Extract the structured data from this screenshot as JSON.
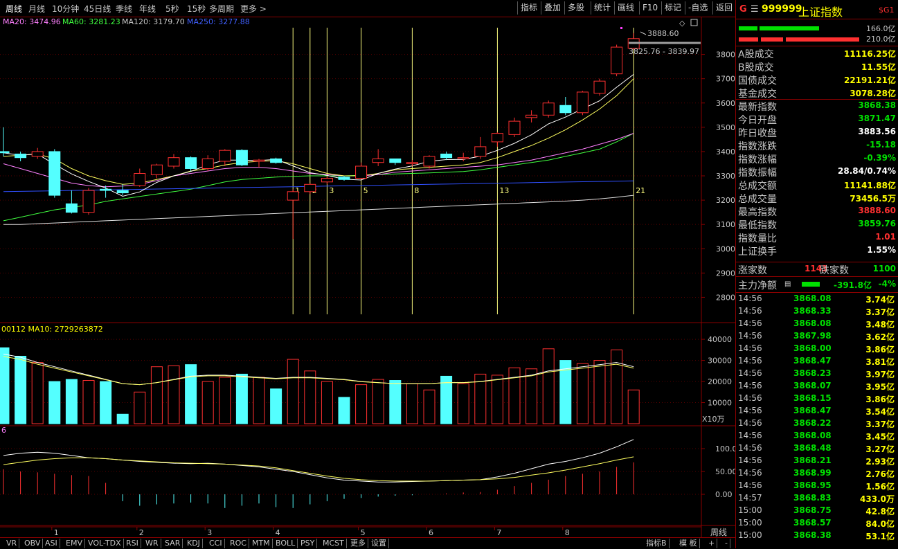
{
  "toolbar": {
    "periods": [
      "周线",
      "月线",
      "10分钟",
      "45日线",
      "季线",
      "年线",
      "5秒",
      "15秒",
      "多周期",
      "更多 >"
    ],
    "active_period": "周线",
    "buttons": [
      "指标",
      "叠加",
      "多股",
      "统计",
      "画线",
      "F10",
      "标记",
      "-自选",
      "返回"
    ]
  },
  "legend": {
    "ma20": "MA20: 3474.96",
    "ma60": "MA60: 3281.23",
    "ma120": "MA120: 3179.70",
    "ma250": "MA250: 3277.88",
    "volume": "00112  MA10: 2729263872",
    "macd_lbl": "6"
  },
  "annotations": {
    "high_price": "3888.60",
    "range": "3825.76 - 3839.97"
  },
  "fib_labels": [
    "1",
    "2",
    "3",
    "5",
    "8",
    "13",
    "21"
  ],
  "volume_unit": "X10万",
  "x_period": "周线",
  "bottom_tabs": [
    "VR",
    "OBV",
    "ASI",
    "EMV",
    "VOL-TDX",
    "RSI",
    "WR",
    "SAR",
    "KDJ",
    "CCI",
    "ROC",
    "MTM",
    "BOLL",
    "PSY",
    "MCST",
    "更多",
    "设置"
  ],
  "bottom_right": [
    "指标B",
    "模 板",
    "+",
    "-"
  ],
  "header": {
    "code": "999999",
    "name": "上证指数",
    "tag": "$G1",
    "g_tag": "G"
  },
  "bars": {
    "v1": "166.0亿",
    "v2": "210.0亿"
  },
  "stats": [
    {
      "label": "A股成交",
      "value": "11116.25亿",
      "color": "#ffff00"
    },
    {
      "label": "B股成交",
      "value": "11.55亿",
      "color": "#ffff00"
    },
    {
      "label": "国债成交",
      "value": "22191.21亿",
      "color": "#ffff00"
    },
    {
      "label": "基金成交",
      "value": "3078.28亿",
      "color": "#ffff00"
    },
    {
      "label": "最新指数",
      "value": "3868.38",
      "color": "#00e000"
    },
    {
      "label": "今日开盘",
      "value": "3871.47",
      "color": "#00e000"
    },
    {
      "label": "昨日收盘",
      "value": "3883.56",
      "color": "#ffffff"
    },
    {
      "label": "指数涨跌",
      "value": "-15.18",
      "color": "#00e000"
    },
    {
      "label": "指数涨幅",
      "value": "-0.39%",
      "color": "#00e000"
    },
    {
      "label": "指数振幅",
      "value": "28.84/0.74%",
      "color": "#ffffff"
    },
    {
      "label": "总成交额",
      "value": "11141.88亿",
      "color": "#ffff00"
    },
    {
      "label": "总成交量",
      "value": "73456.5万",
      "color": "#ffff00"
    },
    {
      "label": "最高指数",
      "value": "3888.60",
      "color": "#ff3030"
    },
    {
      "label": "最低指数",
      "value": "3859.76",
      "color": "#00e000"
    },
    {
      "label": "指数量比",
      "value": "1.01",
      "color": "#ff3030"
    },
    {
      "label": "上证换手",
      "value": "1.55%",
      "color": "#ffffff"
    }
  ],
  "updown": {
    "up_label": "涨家数",
    "up": "1143",
    "down_label": "跌家数",
    "down": "1100"
  },
  "mainflow": {
    "label": "主力净额",
    "value": "-391.8亿",
    "pct": "-4%"
  },
  "ticks": [
    {
      "t": "14:56",
      "p": "3868.08",
      "v": "3.74亿"
    },
    {
      "t": "14:56",
      "p": "3868.33",
      "v": "3.37亿"
    },
    {
      "t": "14:56",
      "p": "3868.08",
      "v": "3.48亿"
    },
    {
      "t": "14:56",
      "p": "3867.98",
      "v": "3.62亿"
    },
    {
      "t": "14:56",
      "p": "3868.00",
      "v": "3.86亿"
    },
    {
      "t": "14:56",
      "p": "3868.47",
      "v": "3.81亿"
    },
    {
      "t": "14:56",
      "p": "3868.23",
      "v": "3.97亿"
    },
    {
      "t": "14:56",
      "p": "3868.07",
      "v": "3.95亿"
    },
    {
      "t": "14:56",
      "p": "3868.15",
      "v": "3.86亿"
    },
    {
      "t": "14:56",
      "p": "3868.47",
      "v": "3.54亿"
    },
    {
      "t": "14:56",
      "p": "3868.22",
      "v": "3.37亿"
    },
    {
      "t": "14:56",
      "p": "3868.08",
      "v": "3.45亿"
    },
    {
      "t": "14:56",
      "p": "3868.48",
      "v": "3.27亿"
    },
    {
      "t": "14:56",
      "p": "3868.21",
      "v": "2.93亿"
    },
    {
      "t": "14:56",
      "p": "3868.99",
      "v": "2.76亿"
    },
    {
      "t": "14:56",
      "p": "3868.95",
      "v": "1.56亿"
    },
    {
      "t": "14:57",
      "p": "3868.83",
      "v": "433.0万"
    },
    {
      "t": "15:00",
      "p": "3868.75",
      "v": "42.8亿"
    },
    {
      "t": "15:00",
      "p": "3868.57",
      "v": "84.0亿"
    },
    {
      "t": "15:00",
      "p": "3868.38",
      "v": "53.1亿"
    }
  ],
  "chart_data": {
    "type": "candlestick",
    "price_ticks": [
      3800,
      3700,
      3600,
      3500,
      3400,
      3300,
      3200,
      3100,
      3000,
      2900,
      2800
    ],
    "price_range": [
      2730,
      3910
    ],
    "x_month_labels": [
      "1",
      "2",
      "3",
      "4",
      "5",
      "6",
      "7",
      "8"
    ],
    "x_month_index": [
      3,
      8,
      12,
      16,
      21,
      25,
      29,
      33
    ],
    "fib_index": [
      17,
      18,
      19,
      21,
      24,
      29,
      37
    ],
    "candles": [
      {
        "o": 3400,
        "c": 3395,
        "h": 3500,
        "l": 3380
      },
      {
        "o": 3390,
        "c": 3375,
        "h": 3400,
        "l": 3360
      },
      {
        "o": 3380,
        "c": 3400,
        "h": 3415,
        "l": 3370
      },
      {
        "o": 3400,
        "c": 3220,
        "h": 3410,
        "l": 3210
      },
      {
        "o": 3185,
        "c": 3150,
        "h": 3240,
        "l": 3145
      },
      {
        "o": 3150,
        "c": 3240,
        "h": 3250,
        "l": 3140
      },
      {
        "o": 3245,
        "c": 3240,
        "h": 3260,
        "l": 3210
      },
      {
        "o": 3240,
        "c": 3230,
        "h": 3265,
        "l": 3220
      },
      {
        "o": 3260,
        "c": 3310,
        "h": 3330,
        "l": 3255
      },
      {
        "o": 3305,
        "c": 3345,
        "h": 3350,
        "l": 3290
      },
      {
        "o": 3340,
        "c": 3375,
        "h": 3390,
        "l": 3330
      },
      {
        "o": 3375,
        "c": 3330,
        "h": 3380,
        "l": 3320
      },
      {
        "o": 3330,
        "c": 3370,
        "h": 3385,
        "l": 3320
      },
      {
        "o": 3360,
        "c": 3405,
        "h": 3410,
        "l": 3340
      },
      {
        "o": 3405,
        "c": 3345,
        "h": 3410,
        "l": 3340
      },
      {
        "o": 3360,
        "c": 3365,
        "h": 3370,
        "l": 3335
      },
      {
        "o": 3370,
        "c": 3355,
        "h": 3375,
        "l": 3350
      },
      {
        "o": 3200,
        "c": 3235,
        "h": 3245,
        "l": 3040
      },
      {
        "o": 3235,
        "c": 3265,
        "h": 3270,
        "l": 3225
      },
      {
        "o": 3275,
        "c": 3290,
        "h": 3300,
        "l": 3265
      },
      {
        "o": 3295,
        "c": 3285,
        "h": 3300,
        "l": 3280
      },
      {
        "o": 3290,
        "c": 3340,
        "h": 3355,
        "l": 3285
      },
      {
        "o": 3355,
        "c": 3370,
        "h": 3410,
        "l": 3340
      },
      {
        "o": 3370,
        "c": 3355,
        "h": 3370,
        "l": 3345
      },
      {
        "o": 3350,
        "c": 3355,
        "h": 3365,
        "l": 3340
      },
      {
        "o": 3340,
        "c": 3380,
        "h": 3385,
        "l": 3330
      },
      {
        "o": 3390,
        "c": 3375,
        "h": 3400,
        "l": 3365
      },
      {
        "o": 3370,
        "c": 3375,
        "h": 3395,
        "l": 3360
      },
      {
        "o": 3380,
        "c": 3420,
        "h": 3460,
        "l": 3370
      },
      {
        "o": 3440,
        "c": 3475,
        "h": 3480,
        "l": 3420
      },
      {
        "o": 3470,
        "c": 3525,
        "h": 3540,
        "l": 3460
      },
      {
        "o": 3540,
        "c": 3550,
        "h": 3570,
        "l": 3520
      },
      {
        "o": 3550,
        "c": 3600,
        "h": 3610,
        "l": 3540
      },
      {
        "o": 3590,
        "c": 3560,
        "h": 3625,
        "l": 3550
      },
      {
        "o": 3560,
        "c": 3645,
        "h": 3650,
        "l": 3550
      },
      {
        "o": 3640,
        "c": 3690,
        "h": 3700,
        "l": 3630
      },
      {
        "o": 3720,
        "c": 3830,
        "h": 3840,
        "l": 3710
      },
      {
        "o": 3825,
        "c": 3865,
        "h": 3888,
        "l": 3820
      }
    ],
    "ma20": [
      3380,
      3385,
      3390,
      3370,
      3330,
      3300,
      3280,
      3265,
      3270,
      3285,
      3300,
      3320,
      3330,
      3345,
      3355,
      3360,
      3362,
      3350,
      3330,
      3310,
      3300,
      3300,
      3310,
      3325,
      3330,
      3335,
      3340,
      3345,
      3355,
      3375,
      3400,
      3425,
      3455,
      3490,
      3530,
      3575,
      3630,
      3700
    ],
    "ma60": [
      3350,
      3330,
      3310,
      3290,
      3270,
      3260,
      3255,
      3258,
      3265,
      3280,
      3300,
      3310,
      3320,
      3330,
      3335,
      3335,
      3330,
      3320,
      3310,
      3305,
      3300,
      3300,
      3305,
      3315,
      3320,
      3325,
      3330,
      3335,
      3340,
      3345,
      3355,
      3365,
      3380,
      3395,
      3410,
      3430,
      3450,
      3475
    ],
    "ma120": [
      3115,
      3130,
      3145,
      3160,
      3170,
      3180,
      3195,
      3205,
      3215,
      3225,
      3235,
      3245,
      3260,
      3275,
      3285,
      3290,
      3295,
      3298,
      3300,
      3300,
      3300,
      3302,
      3305,
      3308,
      3310,
      3312,
      3315,
      3318,
      3325,
      3335,
      3345,
      3355,
      3365,
      3380,
      3395,
      3410,
      3440,
      3475
    ],
    "ma250": [
      3100,
      3100,
      3103,
      3106,
      3109,
      3112,
      3115,
      3118,
      3121,
      3124,
      3127,
      3130,
      3133,
      3136,
      3139,
      3142,
      3145,
      3148,
      3151,
      3154,
      3157,
      3160,
      3163,
      3166,
      3169,
      3172,
      3175,
      3178,
      3181,
      3184,
      3187,
      3190,
      3193,
      3196,
      3200,
      3205,
      3212,
      3220
    ],
    "vol_ticks": [
      40000,
      30000,
      20000,
      10000
    ],
    "volume": [
      36000,
      32000,
      29000,
      20000,
      21000,
      20500,
      20000,
      4500,
      15000,
      27000,
      27500,
      28000,
      20000,
      22000,
      23500,
      22000,
      16500,
      30500,
      25000,
      20000,
      12500,
      18500,
      21000,
      20500,
      19000,
      16000,
      22500,
      19000,
      23500,
      23000,
      26500,
      26000,
      35500,
      30000,
      28500,
      30000,
      35000,
      16000
    ],
    "vol_ma": [
      33000,
      31500,
      29000,
      27000,
      25000,
      23000,
      21000,
      19000,
      18500,
      19500,
      21000,
      22500,
      23000,
      23000,
      22500,
      22000,
      21500,
      22000,
      22000,
      21500,
      21000,
      20000,
      19500,
      19000,
      19000,
      19000,
      19500,
      19500,
      20000,
      21000,
      22000,
      23000,
      25000,
      26000,
      27000,
      28000,
      29000,
      27000
    ],
    "macd_ticks": [
      100,
      50,
      0
    ],
    "macd_diff": [
      85,
      90,
      92,
      90,
      85,
      80,
      78,
      75,
      72,
      70,
      68,
      67,
      68,
      66,
      63,
      60,
      55,
      50,
      43,
      36,
      31,
      29,
      27,
      27,
      28,
      29,
      30,
      31,
      32,
      38,
      46,
      56,
      66,
      72,
      80,
      90,
      104,
      120
    ],
    "macd_dea": [
      65,
      70,
      75,
      78,
      80,
      80,
      78,
      75,
      73,
      71,
      69,
      68,
      67,
      66,
      64,
      62,
      58,
      52,
      46,
      40,
      35,
      32,
      30,
      29,
      29,
      29,
      30,
      31,
      32,
      34,
      37,
      42,
      47,
      53,
      60,
      67,
      75,
      82
    ],
    "macd_bars": [
      55,
      50,
      48,
      45,
      42,
      40,
      25,
      -15,
      -25,
      -22,
      -20,
      -18,
      -20,
      -30,
      -25,
      -20,
      -28,
      -30,
      -22,
      -15,
      -10,
      -8,
      -5,
      -3,
      -2,
      0,
      2,
      4,
      5,
      10,
      18,
      25,
      32,
      40,
      45,
      50,
      60,
      70
    ]
  }
}
